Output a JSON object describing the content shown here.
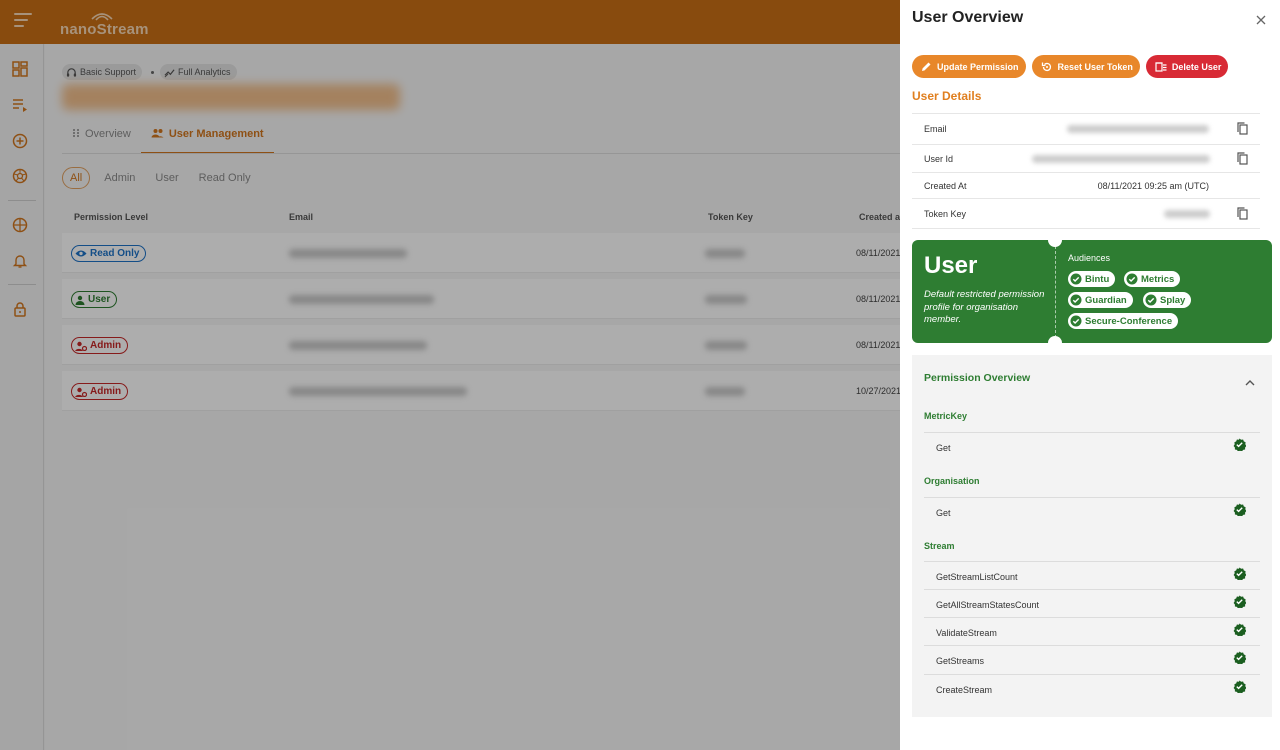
{
  "app": {
    "brand": "nanoStream"
  },
  "header": {
    "chips": [
      {
        "label": "Basic Support",
        "icon": "headset-icon"
      },
      {
        "label": "Full Analytics",
        "icon": "analytics-icon"
      }
    ]
  },
  "tabs": [
    {
      "label": "Overview",
      "icon": "drag-handle-icon",
      "active": false
    },
    {
      "label": "User Management",
      "icon": "users-icon",
      "active": true
    }
  ],
  "filters": [
    "All",
    "Admin",
    "User",
    "Read Only"
  ],
  "table": {
    "columns": [
      "Permission Level",
      "Email",
      "Token Key",
      "Created a"
    ],
    "rows": [
      {
        "level": "Read Only",
        "kind": "read",
        "date": "08/11/2021"
      },
      {
        "level": "User",
        "kind": "user",
        "date": "08/11/2021"
      },
      {
        "level": "Admin",
        "kind": "admin",
        "date": "08/11/2021"
      },
      {
        "level": "Admin",
        "kind": "admin",
        "date": "10/27/2021"
      }
    ]
  },
  "drawer": {
    "title": "User Overview",
    "actions": [
      {
        "label": "Update Permission",
        "icon": "pencil-icon",
        "color": "#e8872a"
      },
      {
        "label": "Reset User Token",
        "icon": "reset-icon",
        "color": "#e8872a"
      },
      {
        "label": "Delete User",
        "icon": "delete-icon",
        "color": "#d82a35"
      }
    ],
    "details_title": "User Details",
    "details": [
      {
        "label": "Email",
        "value": "",
        "hidden": true,
        "copy": true
      },
      {
        "label": "User Id",
        "value": "",
        "hidden": true,
        "copy": true
      },
      {
        "label": "Created At",
        "value": "08/11/2021 09:25 am (UTC)",
        "hidden": false,
        "copy": false
      },
      {
        "label": "Token Key",
        "value": "",
        "hidden": true,
        "copy": true
      }
    ],
    "role_card": {
      "role": "User",
      "description": "Default restricted permission profile for organisation member.",
      "audiences_label": "Audiences",
      "audiences": [
        "Bintu",
        "Metrics",
        "Guardian",
        "Splay",
        "Secure-Conference"
      ],
      "color": "#2e7d32"
    },
    "permissions": {
      "title": "Permission Overview",
      "groups": [
        {
          "name": "MetricKey",
          "items": [
            "Get"
          ]
        },
        {
          "name": "Organisation",
          "items": [
            "Get"
          ]
        },
        {
          "name": "Stream",
          "items": [
            "GetStreamListCount",
            "GetAllStreamStatesCount",
            "ValidateStream",
            "GetStreams",
            "CreateStream"
          ]
        }
      ]
    }
  }
}
